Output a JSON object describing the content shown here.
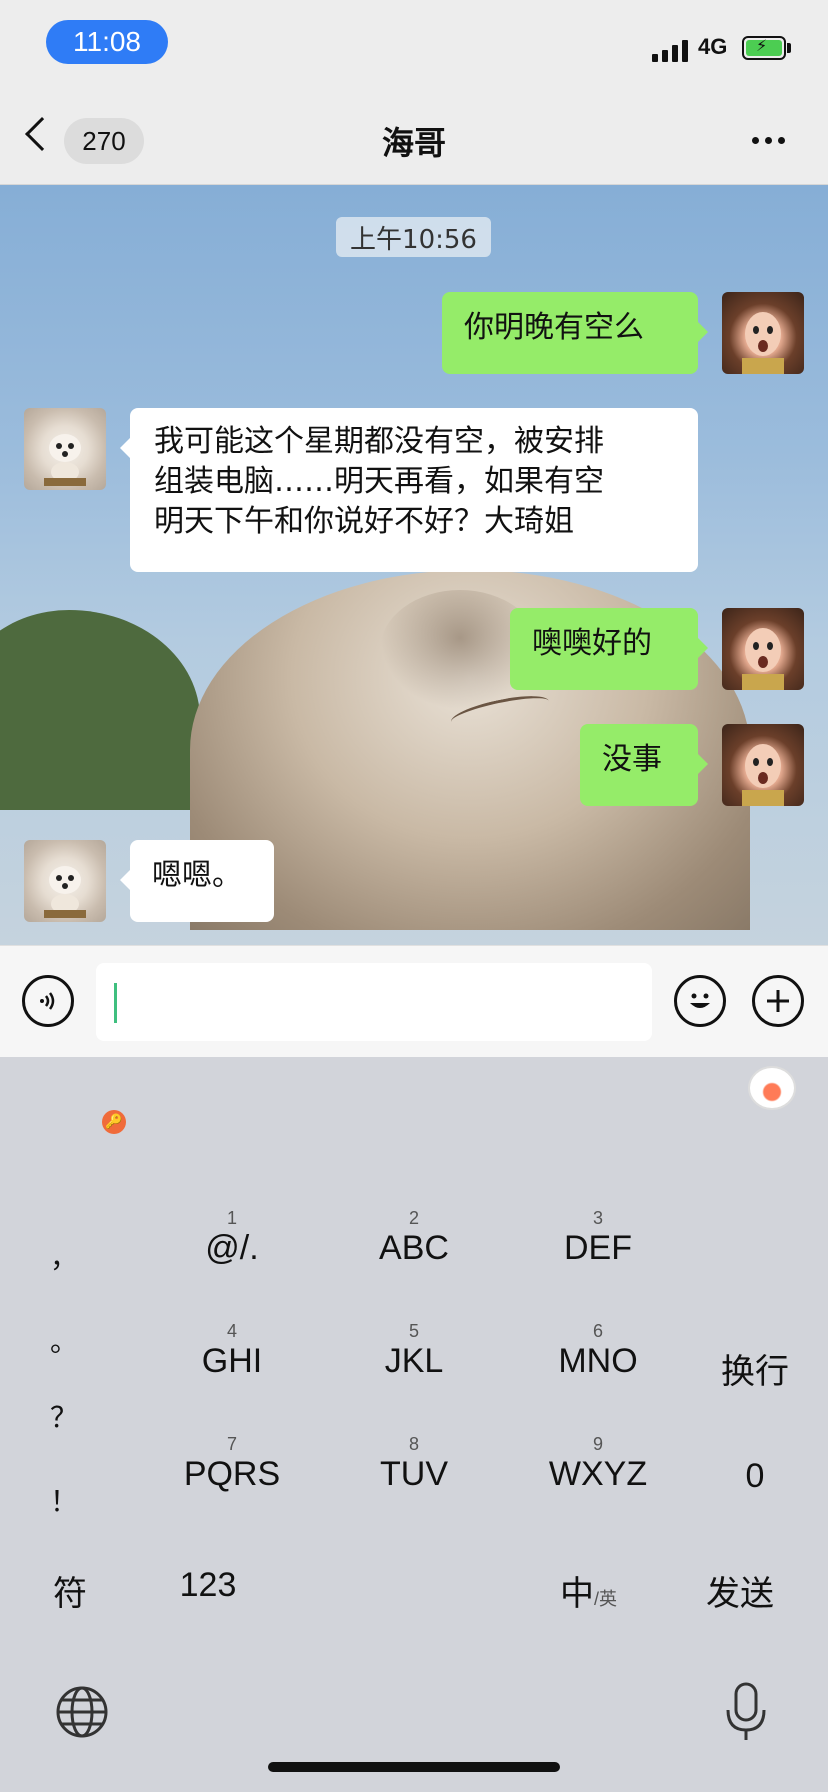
{
  "status_bar": {
    "time": "11:08",
    "network": "4G"
  },
  "nav": {
    "back_count": "270",
    "title": "海哥"
  },
  "chat": {
    "timestamp": "上午10:56",
    "messages": [
      {
        "from": "me",
        "text": "你明晚有空么"
      },
      {
        "from": "them",
        "lines": [
          "我可能这个星期都没有空，被安排",
          "组装电脑……明天再看，如果有空",
          "明天下午和你说好不好？大琦姐"
        ]
      },
      {
        "from": "me",
        "text": "噢噢好的"
      },
      {
        "from": "me",
        "text": "没事"
      },
      {
        "from": "them",
        "text": "嗯嗯。"
      }
    ]
  },
  "input_bar": {
    "left_icon": "voice-icon",
    "emoji_icon": "emoji-icon",
    "plus_icon": "plus-icon"
  },
  "keyboard": {
    "punctuation": [
      "，",
      "。",
      "？",
      "！"
    ],
    "keys": [
      {
        "num": "1",
        "label": "@/."
      },
      {
        "num": "2",
        "label": "ABC"
      },
      {
        "num": "3",
        "label": "DEF"
      },
      {
        "num": "4",
        "label": "GHI"
      },
      {
        "num": "5",
        "label": "JKL"
      },
      {
        "num": "6",
        "label": "MNO"
      },
      {
        "num": "7",
        "label": "PQRS"
      },
      {
        "num": "8",
        "label": "TUV"
      },
      {
        "num": "9",
        "label": "WXYZ"
      }
    ],
    "newline": "换行",
    "zero": "0",
    "symbols": "符",
    "num_mode": "123",
    "lang_main": "中",
    "lang_sub": "英",
    "send": "发送",
    "globe_icon": "globe-icon",
    "mic_icon": "microphone-icon"
  },
  "colors": {
    "my_bubble": "#95ec69",
    "their_bubble": "#ffffff",
    "time_pill": "#2f7cf6"
  }
}
